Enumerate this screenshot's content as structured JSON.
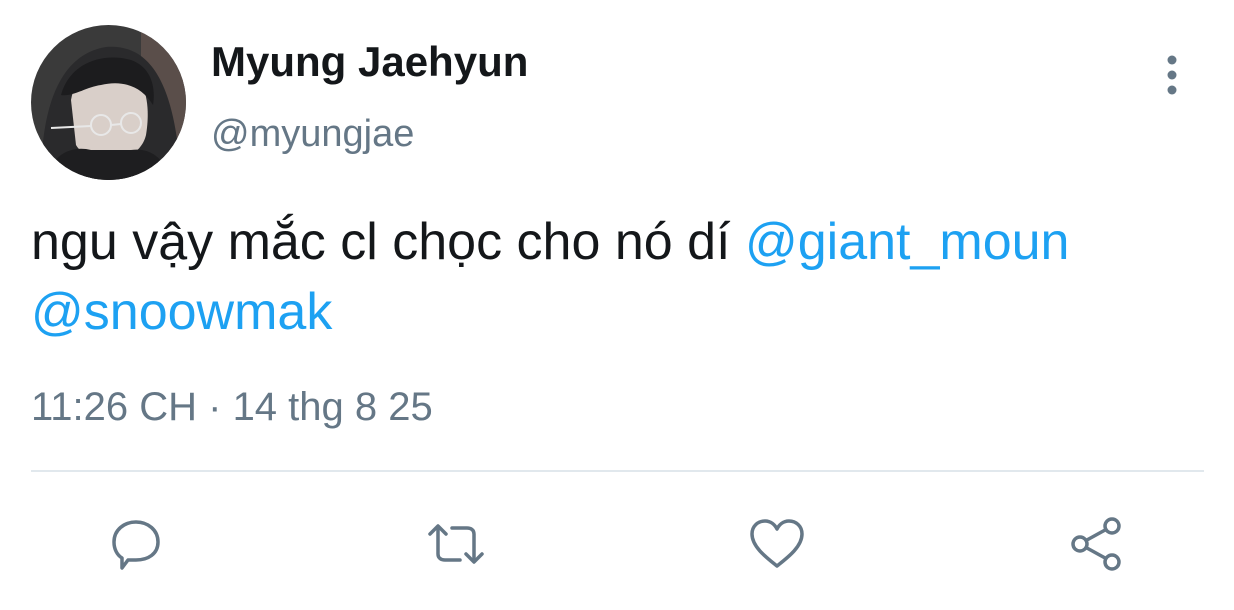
{
  "tweet": {
    "author": {
      "display_name": "Myung Jaehyun",
      "handle": "@myungjae",
      "avatar_icon": "profile-photo"
    },
    "text_plain": "ngu vậy mắc cl chọc cho nó dí ",
    "mentions": [
      "@giant_moun",
      "@snoowmak"
    ],
    "timestamp": "11:26 CH · 14 thg 8 25"
  },
  "actions": [
    {
      "icon": "reply-icon"
    },
    {
      "icon": "retweet-icon"
    },
    {
      "icon": "like-icon"
    },
    {
      "icon": "share-icon"
    }
  ],
  "colors": {
    "text": "#14171a",
    "secondary": "#657786",
    "link": "#1da1f2",
    "divider": "#e1e8ed"
  }
}
